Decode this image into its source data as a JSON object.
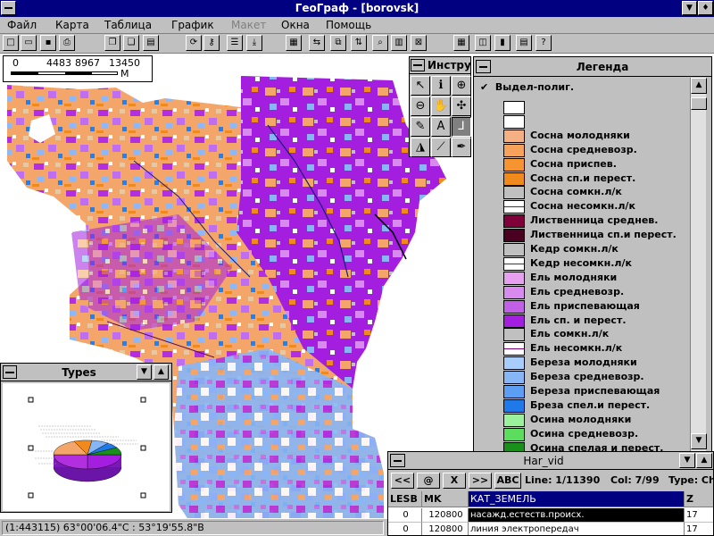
{
  "window": {
    "title": "ГеоГраф - [borovsk]",
    "min_icon": "minimize-arrow-icon",
    "restore_icon": "restore-arrows-icon"
  },
  "menu": [
    {
      "label": "Файл",
      "enabled": true
    },
    {
      "label": "Карта",
      "enabled": true
    },
    {
      "label": "Таблица",
      "enabled": true
    },
    {
      "label": "График",
      "enabled": true
    },
    {
      "label": "Макет",
      "enabled": false
    },
    {
      "label": "Окна",
      "enabled": true
    },
    {
      "label": "Помощь",
      "enabled": true
    }
  ],
  "toolbar": [
    {
      "icon": "new-file-icon",
      "glyph": "□"
    },
    {
      "icon": "open-folder-icon",
      "glyph": "▭"
    },
    {
      "icon": "save-disk-icon",
      "glyph": "▪"
    },
    {
      "icon": "print-icon",
      "glyph": "⎙"
    },
    {
      "icon": "copy-map-icon",
      "glyph": "❐"
    },
    {
      "icon": "paste-icon",
      "glyph": "❏"
    },
    {
      "icon": "layers-icon",
      "glyph": "▤"
    },
    {
      "icon": "sync-icon",
      "glyph": "⟳"
    },
    {
      "icon": "key-icon",
      "glyph": "⚷"
    },
    {
      "icon": "list-icon",
      "glyph": "☰"
    },
    {
      "icon": "import-icon",
      "glyph": "⤓"
    },
    {
      "icon": "edit-table-icon",
      "glyph": "▦"
    },
    {
      "icon": "relation-icon",
      "glyph": "⇆"
    },
    {
      "icon": "merge-icon",
      "glyph": "⧉"
    },
    {
      "icon": "sort-icon",
      "glyph": "⇅"
    },
    {
      "icon": "binoculars-icon",
      "glyph": "⌕"
    },
    {
      "icon": "table-query-icon",
      "glyph": "▥"
    },
    {
      "icon": "table-delete-icon",
      "glyph": "⊠"
    },
    {
      "icon": "spreadsheet-icon",
      "glyph": "▦"
    },
    {
      "icon": "map-legend-icon",
      "glyph": "◫"
    },
    {
      "icon": "bar-chart-icon",
      "glyph": "▮"
    },
    {
      "icon": "report-icon",
      "glyph": "▤"
    },
    {
      "icon": "help-icon",
      "glyph": "?"
    }
  ],
  "scale": {
    "ticks": [
      "0",
      "4483",
      "8967",
      "13450"
    ],
    "unit": "М"
  },
  "instruments": {
    "title": "Инстру",
    "tools": [
      {
        "name": "pointer-tool",
        "glyph": "↖"
      },
      {
        "name": "info-tool",
        "glyph": "ℹ"
      },
      {
        "name": "zoom-in-tool",
        "glyph": "⊕"
      },
      {
        "name": "zoom-out-tool",
        "glyph": "⊖"
      },
      {
        "name": "pan-hand-tool",
        "glyph": "✋"
      },
      {
        "name": "zoom-extent-tool",
        "glyph": "✣"
      },
      {
        "name": "draw-polyline-tool",
        "glyph": "✎"
      },
      {
        "name": "text-tool",
        "glyph": "A"
      },
      {
        "name": "label-tool",
        "glyph": "⅃",
        "active": true
      },
      {
        "name": "fill-tool",
        "glyph": "◮"
      },
      {
        "name": "measure-tool",
        "glyph": "⟋"
      },
      {
        "name": "pen-tool",
        "glyph": "✒"
      }
    ]
  },
  "legend": {
    "title": "Легенда",
    "layer": "Выдел-полиг.",
    "items": [
      {
        "label": "",
        "color": "#ffffff",
        "pattern": "solid"
      },
      {
        "label": "",
        "color": "#ffffff",
        "pattern": "solid"
      },
      {
        "label": "Сосна молодняки",
        "color": "#f4b083",
        "pattern": "solid"
      },
      {
        "label": "Сосна средневозр.",
        "color": "#f7a25a",
        "pattern": "solid"
      },
      {
        "label": "Сосна приспев.",
        "color": "#f59431",
        "pattern": "solid"
      },
      {
        "label": "Сосна сп.и перест.",
        "color": "#f08a1c",
        "pattern": "solid"
      },
      {
        "label": "Сосна сомкн.л/к",
        "color": "#c00000",
        "pattern": "hatch-red"
      },
      {
        "label": "Сосна несомкн.л/к",
        "color": "#c00000",
        "pattern": "line-red"
      },
      {
        "label": "Лиственница  среднев.",
        "color": "#80003a",
        "pattern": "solid"
      },
      {
        "label": "Лиственница  сп.и перест.",
        "color": "#4a0020",
        "pattern": "solid"
      },
      {
        "label": "Кедр сомкн.л/к",
        "color": "#c00000",
        "pattern": "hatch-red"
      },
      {
        "label": "Кедр несомкн.л/к",
        "color": "#c00000",
        "pattern": "line-red"
      },
      {
        "label": "Ель молодняки",
        "color": "#e7a0f0",
        "pattern": "solid"
      },
      {
        "label": "Ель средневозр.",
        "color": "#d98aee",
        "pattern": "solid"
      },
      {
        "label": "Ель  приспевающая",
        "color": "#c160e6",
        "pattern": "solid"
      },
      {
        "label": "Ель сп. и перест.",
        "color": "#a41ee0",
        "pattern": "solid"
      },
      {
        "label": "Ель сомкн.л/к",
        "color": "#c000c0",
        "pattern": "hatch-mag"
      },
      {
        "label": "Ель несомкн.л/к",
        "color": "#800080",
        "pattern": "line-mag"
      },
      {
        "label": "Береза молодняки",
        "color": "#a9cdfb",
        "pattern": "solid"
      },
      {
        "label": "Береза средневозр.",
        "color": "#87b6f7",
        "pattern": "solid"
      },
      {
        "label": "Береза приспевающая",
        "color": "#5c9ef3",
        "pattern": "solid"
      },
      {
        "label": "Бреза спел.и перест.",
        "color": "#1f79e9",
        "pattern": "solid"
      },
      {
        "label": "Осина молодняки",
        "color": "#9cf29c",
        "pattern": "solid"
      },
      {
        "label": "Осина средневозр.",
        "color": "#5ddd5d",
        "pattern": "solid"
      },
      {
        "label": "Осина спелая и перест.",
        "color": "#18901a",
        "pattern": "solid"
      }
    ]
  },
  "types": {
    "title": "Types"
  },
  "harvid": {
    "title": "Har_vid",
    "buttons": [
      "<<",
      "@",
      "X",
      ">>",
      "ABC"
    ],
    "line_info": "Line: 1/11390",
    "col_info": "Col: 7/99",
    "type_info": "Type: Ch",
    "columns": [
      "LESB",
      "MK",
      "КАТ_ЗЕМЕЛЬ",
      "Z"
    ],
    "rows": [
      [
        "0",
        "120800",
        "насажд.естеств.происх.",
        "17"
      ],
      [
        "0",
        "120800",
        "линия электропередач",
        "17"
      ]
    ]
  },
  "status": {
    "text": "(1:443115)  63°00'06.4\"С  :  53°19'55.8\"В"
  },
  "colors": {
    "title_bg": "#000080",
    "chrome": "#c0c0c0"
  }
}
